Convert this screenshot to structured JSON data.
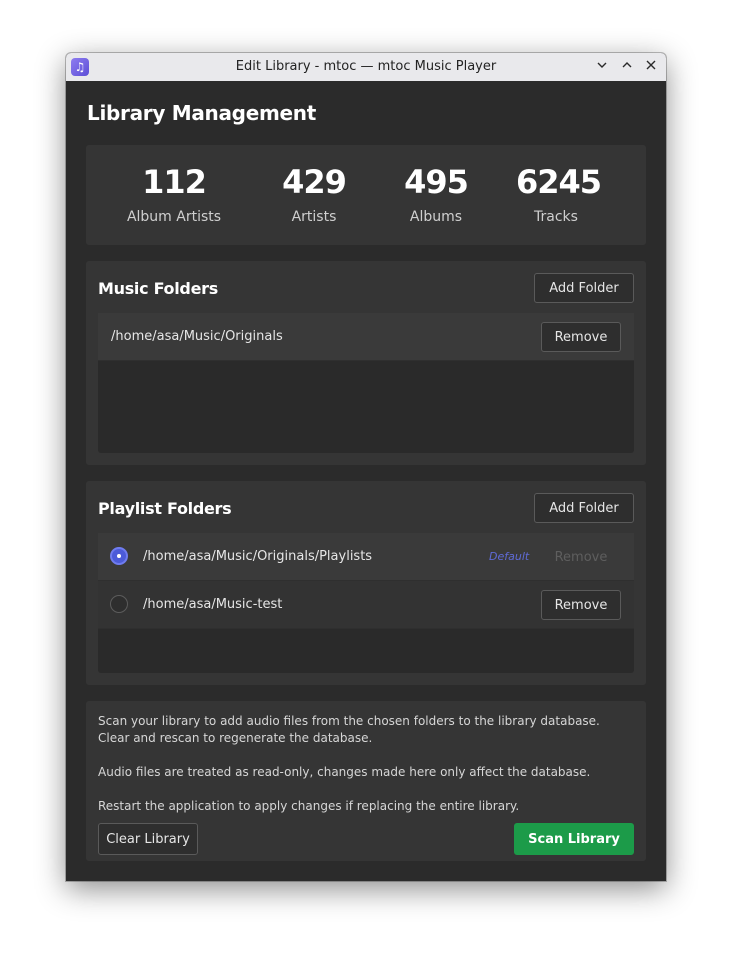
{
  "window": {
    "title": "Edit Library - mtoc — mtoc Music Player"
  },
  "page": {
    "heading": "Library Management"
  },
  "stats": [
    {
      "value": "112",
      "label": "Album Artists"
    },
    {
      "value": "429",
      "label": "Artists"
    },
    {
      "value": "495",
      "label": "Albums"
    },
    {
      "value": "6245",
      "label": "Tracks"
    }
  ],
  "music_folders": {
    "title": "Music Folders",
    "add_label": "Add Folder",
    "items": [
      {
        "path": "/home/asa/Music/Originals",
        "remove_label": "Remove"
      }
    ]
  },
  "playlist_folders": {
    "title": "Playlist Folders",
    "add_label": "Add Folder",
    "default_label": "Default",
    "items": [
      {
        "path": "/home/asa/Music/Originals/Playlists",
        "remove_label": "Remove",
        "selected": true,
        "remove_enabled": false
      },
      {
        "path": "/home/asa/Music-test",
        "remove_label": "Remove",
        "selected": false,
        "remove_enabled": true
      }
    ]
  },
  "scan": {
    "line1": "Scan your library to add audio files from the chosen folders to the library database. Clear and rescan to regenerate the database.",
    "line2": "Audio files are treated as read-only, changes made here only affect the database.",
    "line3": "Restart the application to apply changes if replacing the entire library.",
    "clear_label": "Clear Library",
    "scan_label": "Scan Library"
  },
  "colors": {
    "accent_green": "#1c9b49",
    "radio_selected": "#4c5bd8",
    "default_tag": "#5f6bd6"
  }
}
